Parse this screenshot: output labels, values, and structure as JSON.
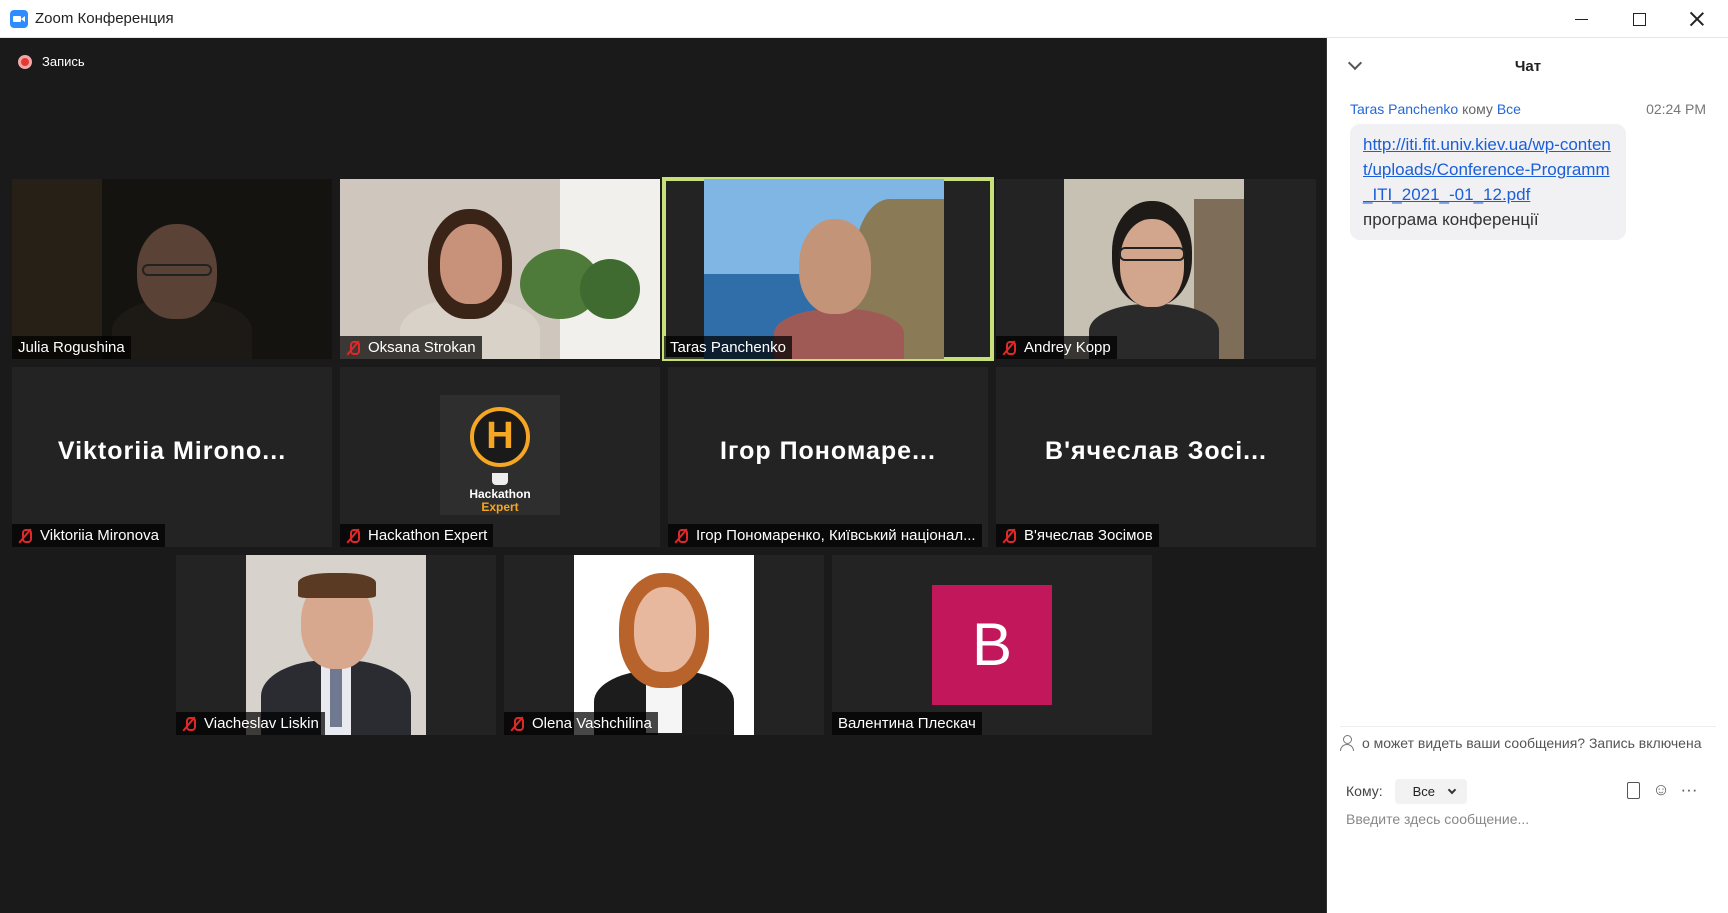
{
  "window": {
    "title": "Zoom Конференция"
  },
  "meeting": {
    "recording_label": "Запись",
    "participants": [
      {
        "name": "Julia Rogushina",
        "muted": false,
        "avatar_text": ""
      },
      {
        "name": "Oksana Strokan",
        "muted": true,
        "avatar_text": ""
      },
      {
        "name": "Taras Panchenko",
        "muted": false,
        "active_speaker": true,
        "avatar_text": ""
      },
      {
        "name": "Andrey Kopp",
        "muted": true,
        "avatar_text": ""
      },
      {
        "name": "Viktoriia Mironova",
        "muted": true,
        "avatar_text": "Viktoriia Mirono..."
      },
      {
        "name": "Hackathon Expert",
        "muted": true,
        "avatar_text": ""
      },
      {
        "name": "Ігор Пономаренко, Київський націонал...",
        "muted": true,
        "avatar_text": "Ігор Пономаре..."
      },
      {
        "name": "В'ячеслав Зосімов",
        "muted": true,
        "avatar_text": "В'ячеслав Зосі..."
      },
      {
        "name": "Viacheslav Liskin",
        "muted": true,
        "avatar_text": ""
      },
      {
        "name": "Olena Vashchilina",
        "muted": true,
        "avatar_text": ""
      },
      {
        "name": "Валентина Плескач",
        "muted": false,
        "avatar_text": "B",
        "avatar_color": "#c2185b"
      }
    ],
    "hackathon_logo": {
      "letter": "H",
      "line1": "Hackathon",
      "line2": "Expert"
    }
  },
  "chat": {
    "title": "Чат",
    "message": {
      "sender": "Taras Panchenko",
      "to_word": "кому",
      "recipient": "Все",
      "time": "02:24 PM",
      "link": "http://iti.fit.univ.kiev.ua/wp-content/uploads/Conference-Programm_ITI_2021_-01_12.pdf",
      "text": "програма конференції"
    },
    "privacy_notice": "о может видеть ваши сообщения? Запись включена",
    "to_label": "Кому:",
    "to_value": "Все",
    "input_placeholder": "Введите здесь сообщение..."
  },
  "colors": {
    "meeting_bg": "#1a1a1a",
    "active_speaker_border": "#c8e07a",
    "link": "#1a5fd8",
    "mute": "#e02828"
  }
}
